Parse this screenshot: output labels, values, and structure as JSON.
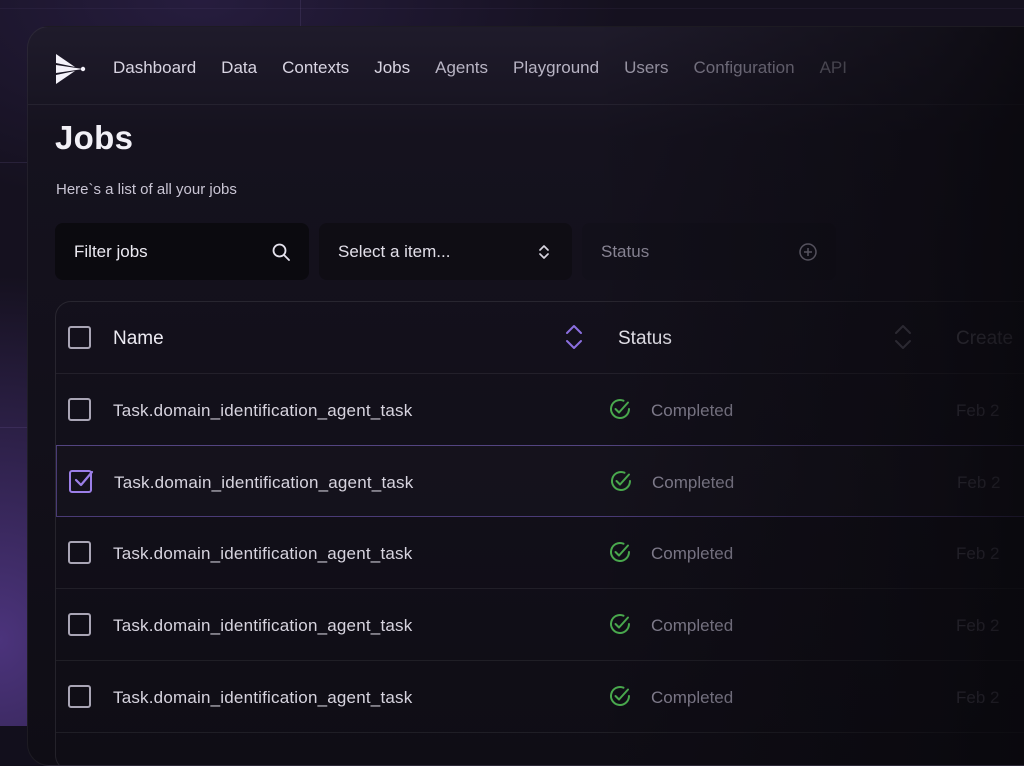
{
  "nav": {
    "items": [
      {
        "label": "Dashboard"
      },
      {
        "label": "Data"
      },
      {
        "label": "Contexts"
      },
      {
        "label": "Jobs"
      },
      {
        "label": "Agents"
      },
      {
        "label": "Playground"
      },
      {
        "label": "Users"
      },
      {
        "label": "Configuration"
      },
      {
        "label": "API"
      }
    ]
  },
  "page": {
    "title": "Jobs",
    "subtitle": "Here`s a list of all your jobs"
  },
  "filters": {
    "search_placeholder": "Filter jobs",
    "select_placeholder": "Select a item...",
    "status_label": "Status"
  },
  "table": {
    "columns": {
      "name": "Name",
      "status": "Status",
      "created": "Create"
    },
    "rows": [
      {
        "name": "Task.domain_identification_agent_task",
        "status": "Completed",
        "created": "Feb 2",
        "selected": false
      },
      {
        "name": "Task.domain_identification_agent_task",
        "status": "Completed",
        "created": "Feb 2",
        "selected": true
      },
      {
        "name": "Task.domain_identification_agent_task",
        "status": "Completed",
        "created": "Feb 2",
        "selected": false
      },
      {
        "name": "Task.domain_identification_agent_task",
        "status": "Completed",
        "created": "Feb 2",
        "selected": false
      },
      {
        "name": "Task.domain_identification_agent_task",
        "status": "Completed",
        "created": "Feb 2",
        "selected": false
      }
    ]
  },
  "colors": {
    "accent": "#9c7fe8",
    "success": "#4caf50"
  }
}
